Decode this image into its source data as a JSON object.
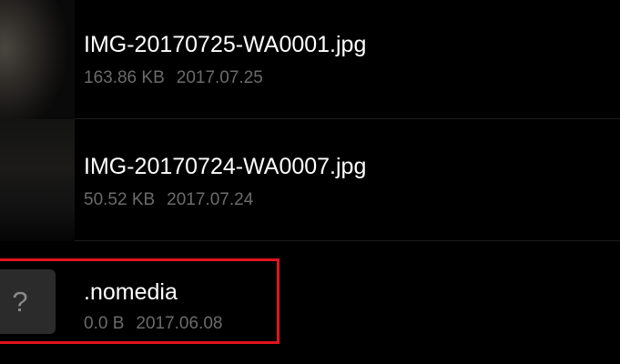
{
  "files": [
    {
      "name": "IMG-20170725-WA0001.jpg",
      "size": "163.86 KB",
      "date": "2017.07.25",
      "thumbnail": "image-thumbnail"
    },
    {
      "name": "IMG-20170724-WA0007.jpg",
      "size": "50.52 KB",
      "date": "2017.07.24",
      "thumbnail": "image-thumbnail"
    },
    {
      "name": ".nomedia",
      "size": "0.0 B",
      "date": "2017.06.08",
      "thumbnail": "unknown-file-icon",
      "icon_glyph": "?"
    }
  ],
  "highlight": {
    "color": "#e0141c",
    "target": ".nomedia"
  }
}
